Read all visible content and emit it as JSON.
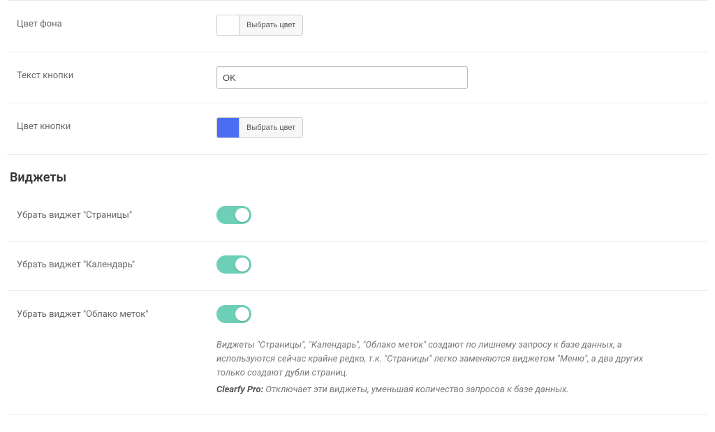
{
  "colors": {
    "accent": "#68d4c1",
    "swatch_bg": "#ffffff",
    "swatch_button": "#4b6df5"
  },
  "fields": {
    "bg_color": {
      "label": "Цвет фона",
      "button": "Выбрать цвет"
    },
    "button_text": {
      "label": "Текст кнопки",
      "value": "OK"
    },
    "button_color": {
      "label": "Цвет кнопки",
      "button": "Выбрать цвет"
    }
  },
  "section": {
    "title": "Виджеты"
  },
  "toggles": [
    {
      "label": "Убрать виджет \"Страницы\"",
      "on": true
    },
    {
      "label": "Убрать виджет \"Календарь\"",
      "on": true
    },
    {
      "label": "Убрать виджет \"Облако меток\"",
      "on": true
    }
  ],
  "description": {
    "p1": "Виджеты \"Страницы\", \"Календарь\", \"Облако меток\" создают по лишнему запросу к базе данных, а используются сейчас крайне редко, т.к. \"Страницы\" легко заменяются виджетом \"Меню\", а два других только создают дубли страниц.",
    "bold": "Clearfy Pro:",
    "p2_rest": " Отключает эти виджеты, уменьшая количество запросов к базе данных."
  }
}
